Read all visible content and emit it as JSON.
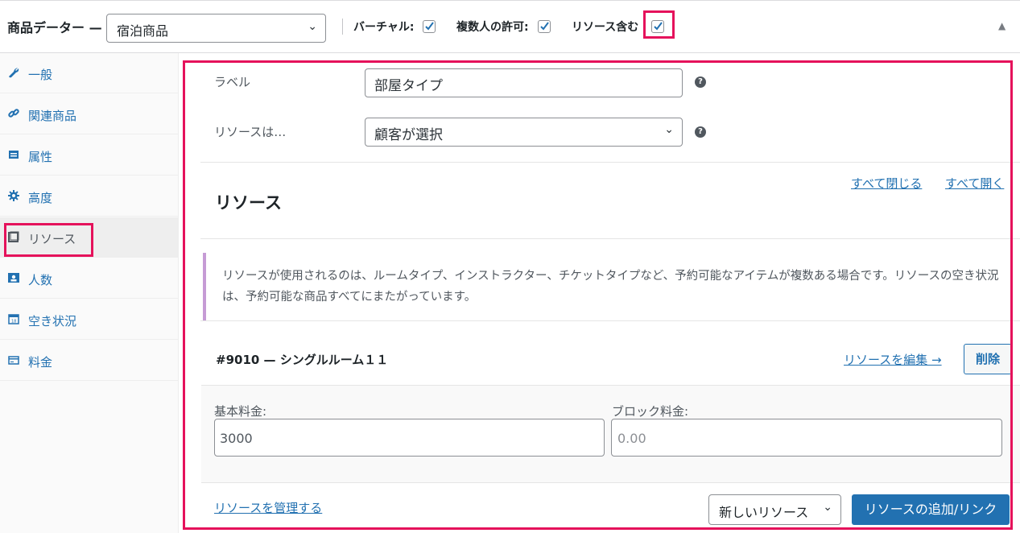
{
  "header": {
    "title": "商品データー —",
    "product_type": "宿泊商品",
    "options": [
      {
        "label": "バーチャル:",
        "checked": true
      },
      {
        "label": "複数人の許可:",
        "checked": true
      },
      {
        "label": "リソース含む",
        "checked": true
      }
    ]
  },
  "sidebar": {
    "items": [
      {
        "label": "一般",
        "icon": "wrench-icon"
      },
      {
        "label": "関連商品",
        "icon": "link-icon"
      },
      {
        "label": "属性",
        "icon": "table-icon"
      },
      {
        "label": "高度",
        "icon": "gear-icon"
      },
      {
        "label": "リソース",
        "icon": "square-icon",
        "active": true
      },
      {
        "label": "人数",
        "icon": "person-card-icon"
      },
      {
        "label": "空き状況",
        "icon": "calendar-icon"
      },
      {
        "label": "料金",
        "icon": "money-icon"
      }
    ]
  },
  "main": {
    "label_field": {
      "label": "ラベル",
      "value": "部屋タイプ"
    },
    "resources_are": {
      "label": "リソースは…",
      "value": "顧客が選択"
    },
    "close_all": "すべて閉じる",
    "open_all": "すべて開く",
    "heading": "リソース",
    "notice": "リソースが使用されるのは、ルームタイプ、インストラクター、チケットタイプなど、予約可能なアイテムが複数ある場合です。リソースの空き状況は、予約可能な商品すべてにまたがっています。",
    "resource": {
      "title": "#9010 — シングルルーム１１",
      "edit_link": "リソースを編集 →",
      "delete": "削除",
      "base_cost_label": "基本料金:",
      "base_cost": "3000",
      "block_cost_label": "ブロック料金:",
      "block_cost_placeholder": "0.00"
    },
    "manage_link": "リソースを管理する",
    "new_resource": "新しいリソース",
    "add_button": "リソースの追加/リンク"
  },
  "colors": {
    "highlight": "#e5125b",
    "primary": "#2271b1",
    "notice_border": "#c69bd5"
  }
}
